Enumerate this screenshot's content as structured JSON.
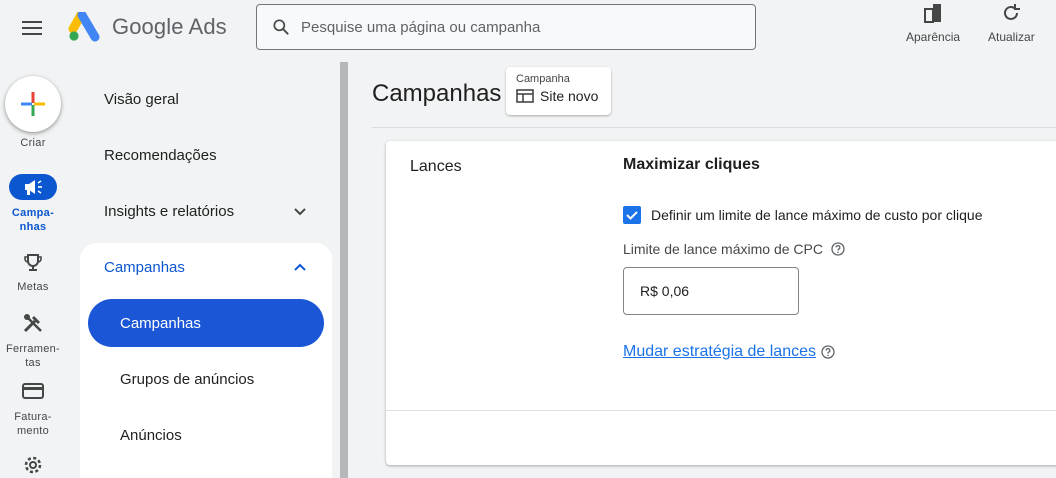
{
  "header": {
    "logo_text": "Google Ads",
    "search_placeholder": "Pesquise uma página ou campanha",
    "appearance_label": "Aparência",
    "refresh_label": "Atualizar"
  },
  "rail": {
    "create_label": "Criar",
    "campaigns_label_1": "Campa-",
    "campaigns_label_2": "nhas",
    "goals_label": "Metas",
    "tools_label_1": "Ferramen-",
    "tools_label_2": "tas",
    "billing_label_1": "Fatura-",
    "billing_label_2": "mento"
  },
  "nav": {
    "overview": "Visão geral",
    "recommendations": "Recomendações",
    "insights": "Insights e relatórios",
    "campaigns_group": "Campanhas",
    "sub_campaigns": "Campanhas",
    "sub_ad_groups": "Grupos de anúncios",
    "sub_ads": "Anúncios"
  },
  "main": {
    "title": "Campanhas",
    "chip_label": "Campanha",
    "chip_value": "Site novo"
  },
  "bidding": {
    "section_label": "Lances",
    "strategy": "Maximizar cliques",
    "checkbox_label": "Definir um limite de lance máximo de custo por clique",
    "checkbox_checked": true,
    "cpc_label": "Limite de lance máximo de CPC",
    "cpc_value": "R$ 0,06",
    "change_link": "Mudar estratégia de lances"
  },
  "colors": {
    "accent": "#0b57d0",
    "link": "#1a73e8",
    "background": "#f1f3f4"
  }
}
